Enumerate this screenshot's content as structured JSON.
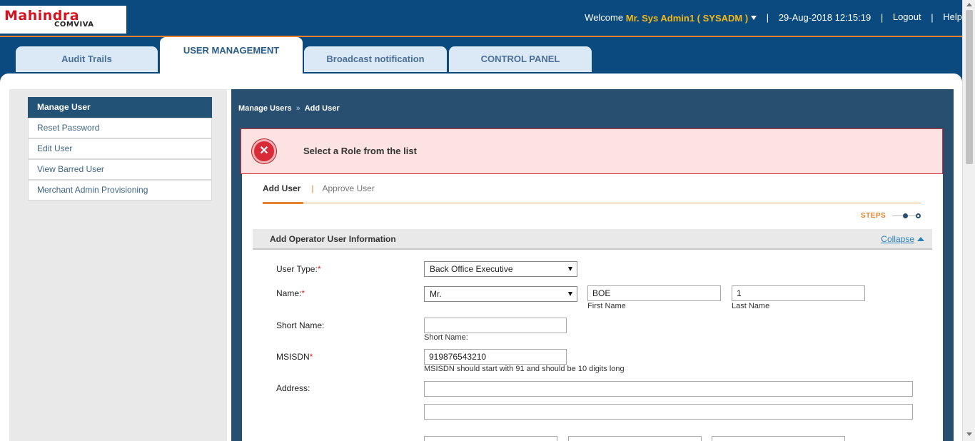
{
  "header": {
    "logo_text": "Mahindra",
    "logo_subtext": "COMVIVA",
    "welcome_label": "Welcome",
    "user_name": "Mr. Sys Admin1 ( SYSADM )",
    "datetime": "29-Aug-2018 12:15:19",
    "logout_label": "Logout",
    "help_label": "Help",
    "separator": "|"
  },
  "tabs": [
    {
      "label": "Audit Trails"
    },
    {
      "label": "USER MANAGEMENT"
    },
    {
      "label": "Broadcast notification"
    },
    {
      "label": "CONTROL PANEL"
    }
  ],
  "sidebar": {
    "items": [
      {
        "label": "Manage User"
      },
      {
        "label": "Reset Password"
      },
      {
        "label": "Edit User"
      },
      {
        "label": "View Barred User"
      },
      {
        "label": "Merchant Admin Provisioning"
      }
    ]
  },
  "breadcrumb": {
    "items": [
      {
        "label": "Manage Users"
      },
      {
        "label": "Add User"
      }
    ],
    "separator": "»"
  },
  "alert": {
    "icon": "error-x-icon",
    "message": "Select a Role from the list",
    "color": "#d92b37"
  },
  "subtabs": [
    {
      "label": "Add User"
    },
    {
      "label": "Approve User"
    }
  ],
  "subtab_separator": "|",
  "steps": {
    "label": "STEPS",
    "current": 1,
    "total": 2
  },
  "section": {
    "title": "Add Operator User Information",
    "collapse_label": "Collapse"
  },
  "form": {
    "user_type": {
      "label": "User Type:",
      "required_mark": "*",
      "value": "Back Office Executive"
    },
    "name": {
      "label": "Name:",
      "required_mark": "*",
      "prefix_value": "Mr.",
      "first_name_value": "BOE",
      "first_name_caption": "First Name",
      "last_name_value": "1",
      "last_name_caption": "Last Name"
    },
    "short_name": {
      "label": "Short Name:",
      "value": "",
      "caption": "Short Name:"
    },
    "msisdn": {
      "label": "MSISDN",
      "required_mark": "*",
      "value": "919876543210",
      "hint": "MSISDN should start with 91 and should be 10 digits long"
    },
    "address": {
      "label": "Address:",
      "line1_value": "",
      "line2_value": ""
    }
  },
  "colors": {
    "header_bg": "#0b4a7f",
    "accent_orange": "#e8822b",
    "user_name": "#f3b817",
    "sidebar_active": "#235277",
    "alert_bg": "#fde2e2"
  }
}
